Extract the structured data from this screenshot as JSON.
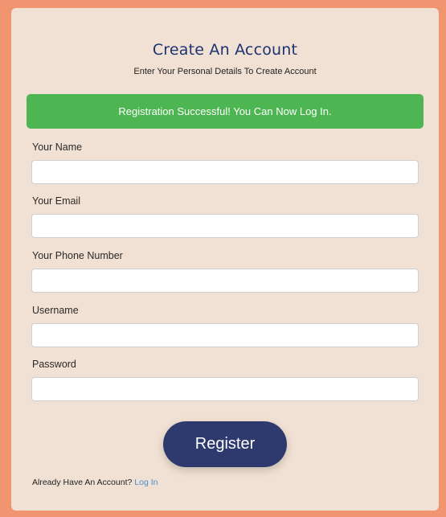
{
  "form": {
    "title": "Create An Account",
    "subtitle": "Enter Your Personal Details To Create Account",
    "alert": "Registration Successful! You Can Now Log In.",
    "fields": [
      {
        "label": "Your Name",
        "value": ""
      },
      {
        "label": "Your Email",
        "value": ""
      },
      {
        "label": "Your Phone Number",
        "value": ""
      },
      {
        "label": "Username",
        "value": ""
      },
      {
        "label": "Password",
        "value": ""
      }
    ],
    "submit_label": "Register",
    "footer_text": "Already Have An Account?",
    "login_link": "Log In"
  },
  "colors": {
    "background": "#f0956f",
    "card": "#f1e1d4",
    "title": "#1d3270",
    "alert": "#4db552",
    "button": "#2e3a6e",
    "link": "#4a8ed0"
  }
}
